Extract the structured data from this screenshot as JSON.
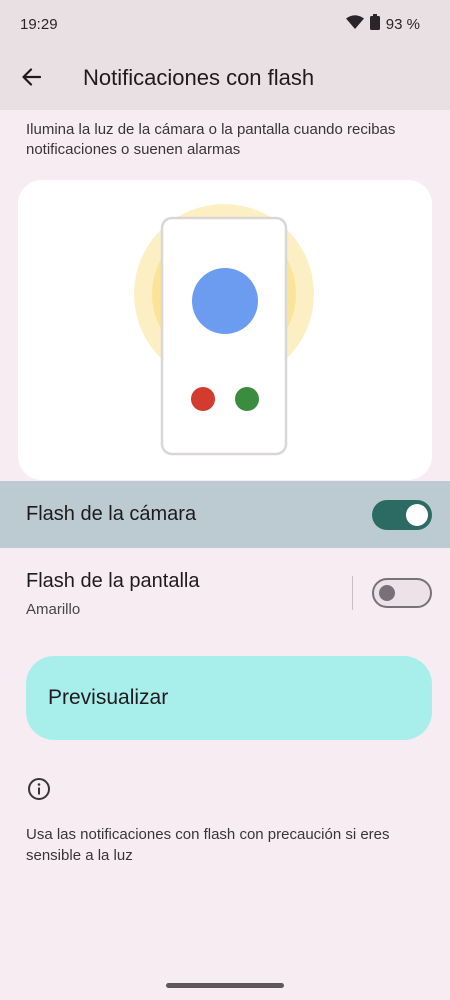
{
  "status_bar": {
    "time": "19:29",
    "battery_text": "93 %",
    "icons": [
      "wifi-icon",
      "battery-icon"
    ]
  },
  "app_bar": {
    "title": "Notificaciones con flash",
    "back_icon": "arrow-back-icon"
  },
  "description": "Ilumina la luz de la cámara o la pantalla cuando recibas notificaciones o suenen alarmas",
  "illustration": {
    "colors": {
      "glow": "#fbe39a",
      "big_dot": "#6b9cf0",
      "red_dot": "#d23b2e",
      "green_dot": "#3a8c3e"
    }
  },
  "settings": {
    "camera_flash": {
      "label": "Flash de la cámara",
      "enabled": true
    },
    "screen_flash": {
      "label": "Flash de la pantalla",
      "subtitle": "Amarillo",
      "enabled": false
    }
  },
  "preview_button": {
    "label": "Previsualizar"
  },
  "info": {
    "icon": "info-icon",
    "text": "Usa las notificaciones con flash con precaución si eres sensible a la luz"
  },
  "colors": {
    "background": "#f8ecf3",
    "app_bar": "#e9e0e4",
    "highlight_row": "#bccad2",
    "toggle_on": "#2c6b64",
    "preview_button": "#a8efec"
  }
}
